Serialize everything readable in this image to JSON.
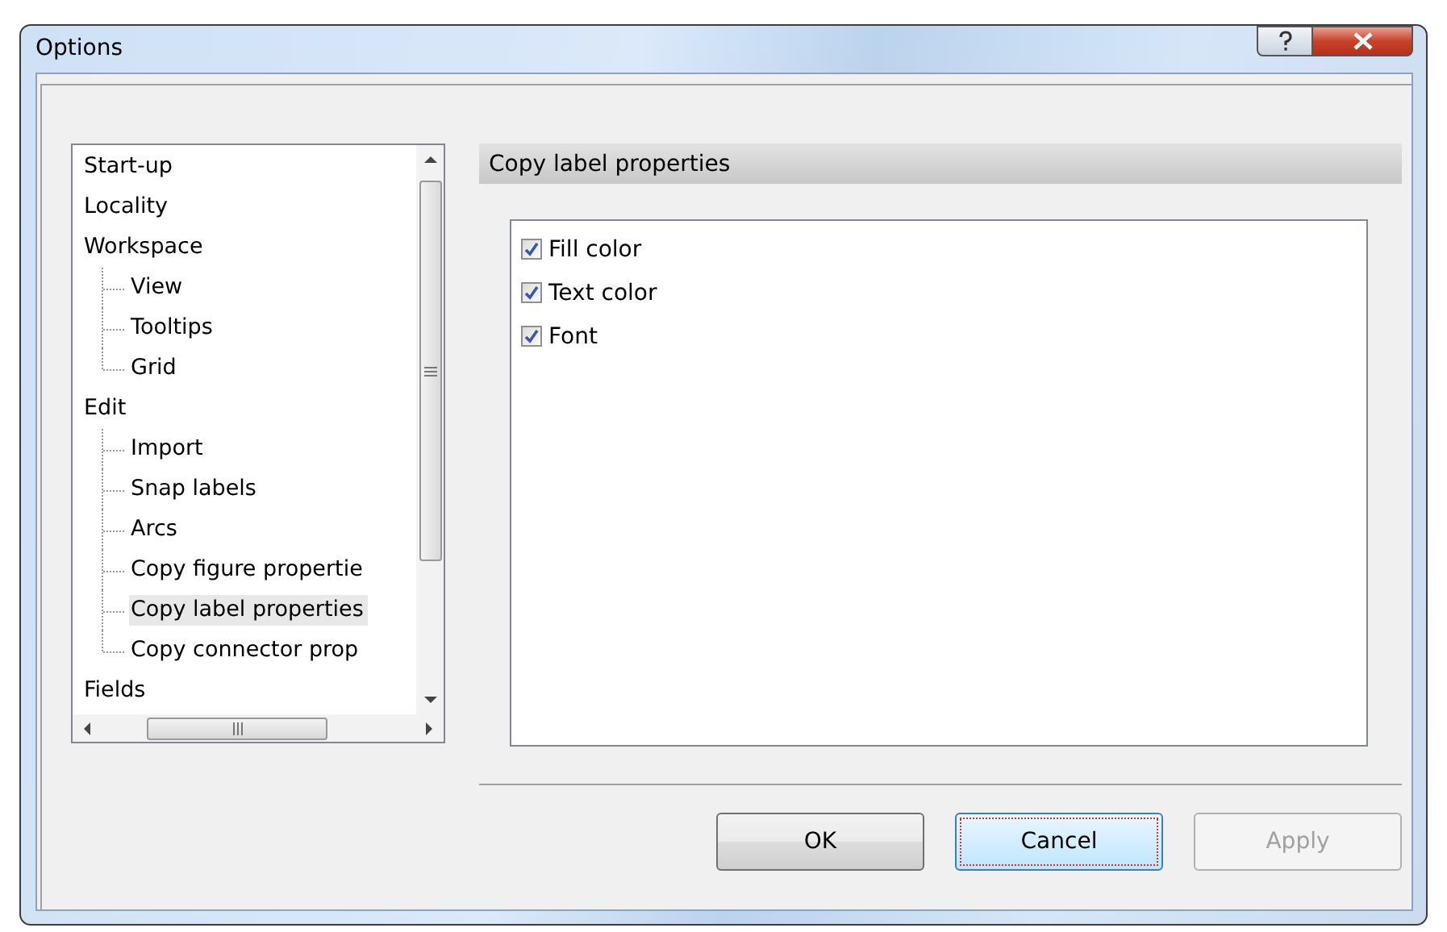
{
  "window": {
    "title": "Options"
  },
  "tree": [
    {
      "label": "Start-up",
      "selected": false
    },
    {
      "label": "Locality",
      "selected": false
    },
    {
      "label": "Workspace",
      "selected": false,
      "children": [
        {
          "label": "View",
          "selected": false
        },
        {
          "label": "Tooltips",
          "selected": false
        },
        {
          "label": "Grid",
          "selected": false
        }
      ]
    },
    {
      "label": "Edit",
      "selected": false,
      "children": [
        {
          "label": "Import",
          "selected": false
        },
        {
          "label": "Snap labels",
          "selected": false
        },
        {
          "label": "Arcs",
          "selected": false
        },
        {
          "label": "Copy figure propertie",
          "selected": false
        },
        {
          "label": "Copy label properties",
          "selected": true
        },
        {
          "label": "Copy connector prop",
          "selected": false
        }
      ]
    },
    {
      "label": "Fields",
      "selected": false
    }
  ],
  "panel": {
    "title": "Copy label properties",
    "options": [
      {
        "label": "Fill color",
        "checked": true
      },
      {
        "label": "Text color",
        "checked": true
      },
      {
        "label": "Font",
        "checked": true
      }
    ]
  },
  "buttons": [
    {
      "label": "OK",
      "focused": false,
      "disabled": false
    },
    {
      "label": "Cancel",
      "focused": true,
      "disabled": false
    },
    {
      "label": "Apply",
      "focused": false,
      "disabled": true
    }
  ]
}
